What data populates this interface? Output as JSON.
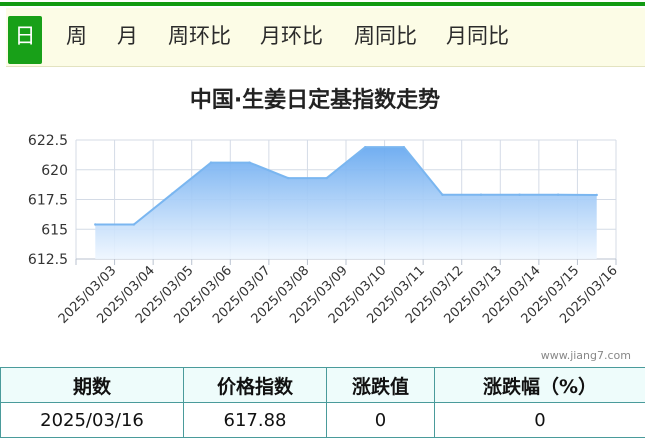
{
  "tabs": [
    {
      "label": "日",
      "active": true
    },
    {
      "label": "周",
      "active": false
    },
    {
      "label": "月",
      "active": false
    },
    {
      "label": "周环比",
      "active": false
    },
    {
      "label": "月环比",
      "active": false
    },
    {
      "label": "周同比",
      "active": false
    },
    {
      "label": "月同比",
      "active": false
    }
  ],
  "colors": {
    "accent": "#129a12",
    "tab_bg": "#fcfce6",
    "line": "#7ab6f0",
    "table_border": "#4a9b9b",
    "table_header_bg": "#eefcfb"
  },
  "chart_data": {
    "type": "area",
    "title": "中国·生姜日定基指数走势",
    "categories": [
      "2025/03/03",
      "2025/03/04",
      "2025/03/05",
      "2025/03/06",
      "2025/03/07",
      "2025/03/08",
      "2025/03/09",
      "2025/03/10",
      "2025/03/11",
      "2025/03/12",
      "2025/03/13",
      "2025/03/14",
      "2025/03/15",
      "2025/03/16"
    ],
    "values": [
      615.4,
      615.4,
      618.0,
      620.6,
      620.6,
      619.3,
      619.3,
      621.9,
      621.9,
      617.9,
      617.9,
      617.9,
      617.9,
      617.88
    ],
    "ylim": [
      612.5,
      622.5
    ],
    "yticks": [
      "612.5",
      "615",
      "617.5",
      "620",
      "622.5"
    ],
    "grid": true,
    "watermark": "www.jiang7.com"
  },
  "table": {
    "headers": [
      "期数",
      "价格指数",
      "涨跌值",
      "涨跌幅（%）"
    ],
    "row": [
      "2025/03/16",
      "617.88",
      "0",
      "0"
    ]
  }
}
